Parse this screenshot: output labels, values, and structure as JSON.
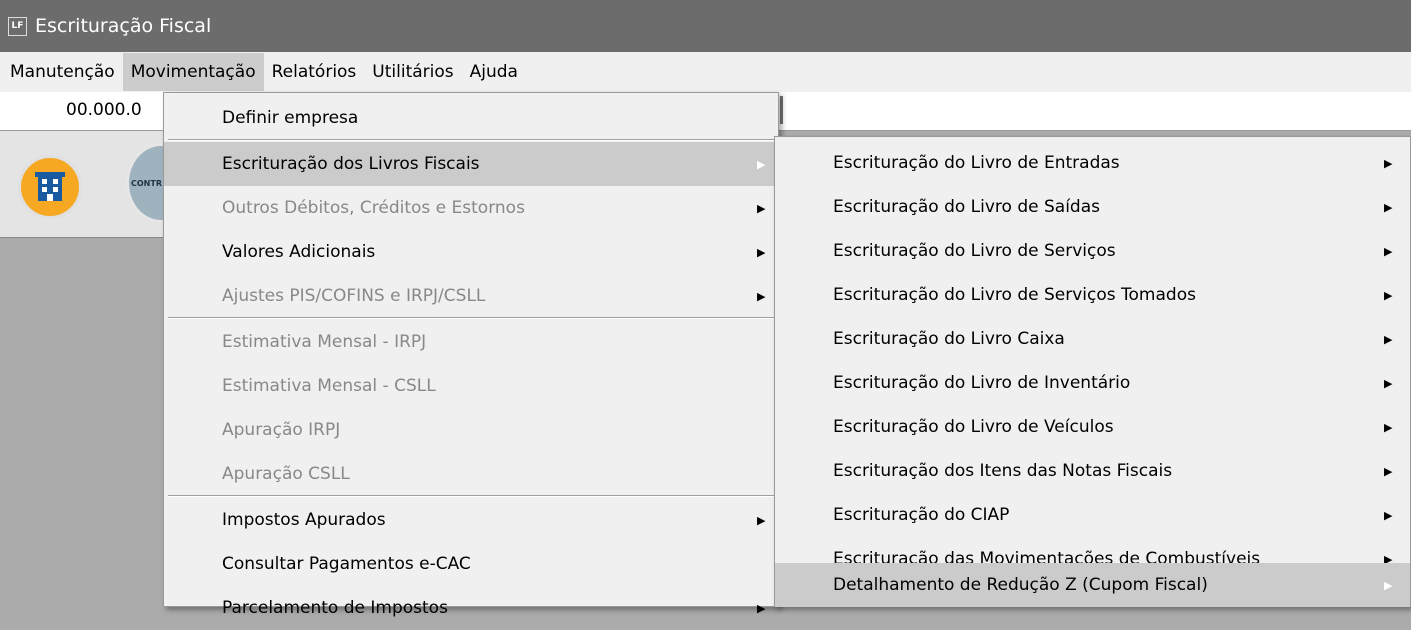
{
  "window": {
    "icon_text": "LF",
    "title": "Escrituração Fiscal"
  },
  "menubar": [
    "Manutenção",
    "Movimentação",
    "Relatórios",
    "Utilitários",
    "Ajuda"
  ],
  "toolbar": {
    "cnpj": "00.000.0"
  },
  "icons": {
    "contr_text": "CONTR"
  },
  "movimentacao_menu": [
    "Definir empresa",
    "Escrituração dos Livros Fiscais",
    "Outros Débitos, Créditos e Estornos",
    "Valores Adicionais",
    "Ajustes PIS/COFINS e IRPJ/CSLL",
    "Estimativa Mensal - IRPJ",
    "Estimativa Mensal - CSLL",
    "Apuração IRPJ",
    "Apuração CSLL",
    "Impostos Apurados",
    "Consultar Pagamentos e-CAC",
    "Parcelamento de Impostos"
  ],
  "escrituracao_submenu": [
    "Escrituração do Livro de Entradas",
    "Escrituração do Livro de Saídas",
    "Escrituração do Livro de Serviços",
    "Escrituração do Livro de Serviços Tomados",
    "Escrituração do Livro Caixa",
    "Escrituração do Livro de Inventário",
    "Escrituração do Livro de Veículos",
    "Escrituração dos Itens das Notas Fiscais",
    "Escrituração do CIAP",
    "Escrituração das Movimentações de Combustíveis",
    "Detalhamento de Redução Z (Cupom Fiscal)"
  ]
}
